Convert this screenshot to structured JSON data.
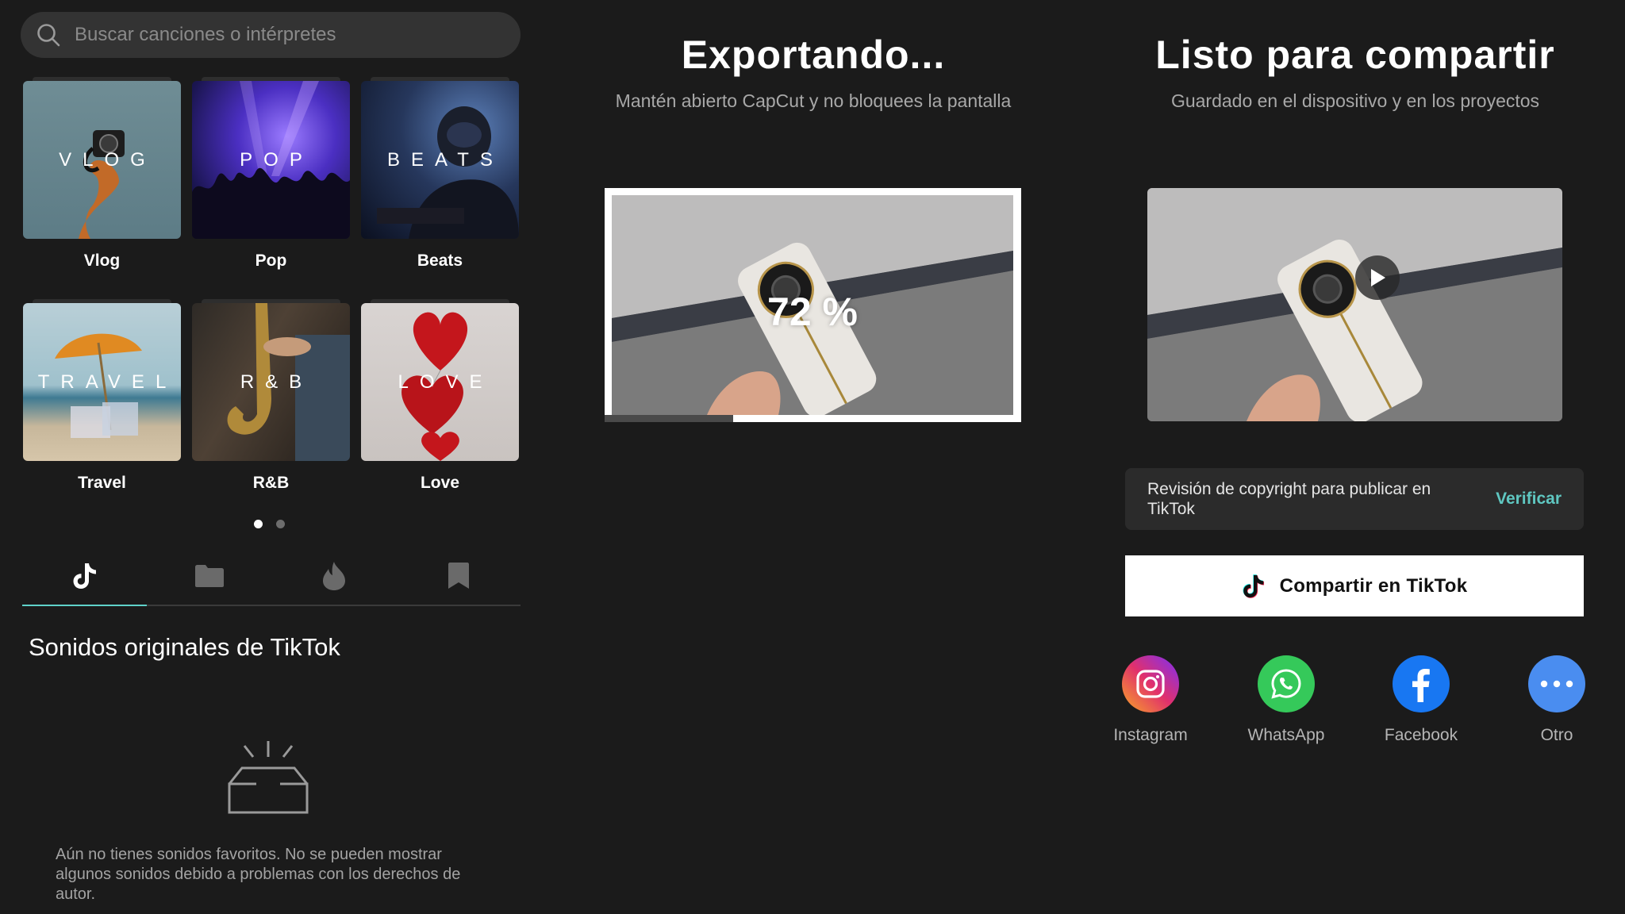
{
  "search": {
    "placeholder": "Buscar canciones o intérpretes"
  },
  "genres": [
    {
      "word": "VLOG",
      "label": "Vlog"
    },
    {
      "word": "POP",
      "label": "Pop"
    },
    {
      "word": "BEATS",
      "label": "Beats"
    },
    {
      "word": "TRAVEL",
      "label": "Travel"
    },
    {
      "word": "R&B",
      "label": "R&B"
    },
    {
      "word": "LOVE",
      "label": "Love"
    }
  ],
  "pager": {
    "pages": 2,
    "current": 1
  },
  "tabs": [
    {
      "icon": "tiktok-icon",
      "active": true
    },
    {
      "icon": "folder-icon",
      "active": false
    },
    {
      "icon": "flame-icon",
      "active": false
    },
    {
      "icon": "bookmark-icon",
      "active": false
    }
  ],
  "sounds": {
    "title": "Sonidos originales de TikTok",
    "empty_message": "Aún no tienes sonidos favoritos. No se pueden mostrar algunos sonidos debido a problemas con los derechos de autor."
  },
  "export": {
    "title": "Exportando...",
    "subtitle": "Mantén abierto CapCut y no bloquees la pantalla",
    "percent_label": "72 %",
    "progress": 0.72
  },
  "ready": {
    "title": "Listo para compartir",
    "subtitle": "Guardado en el dispositivo y en los proyectos"
  },
  "copyright": {
    "text": "Revisión de copyright para publicar en TikTok",
    "action": "Verificar"
  },
  "share_tiktok": {
    "label": "Compartir en TikTok"
  },
  "social": [
    {
      "label": "Instagram",
      "icon": "instagram-icon"
    },
    {
      "label": "WhatsApp",
      "icon": "whatsapp-icon"
    },
    {
      "label": "Facebook",
      "icon": "facebook-icon"
    },
    {
      "label": "Otro",
      "icon": "more-icon"
    }
  ],
  "colors": {
    "background": "#1b1b1b",
    "accent": "#5fc7c1",
    "instagram": "#d6249f",
    "whatsapp": "#25d366",
    "facebook": "#1877f2",
    "other": "#4a8df0"
  }
}
